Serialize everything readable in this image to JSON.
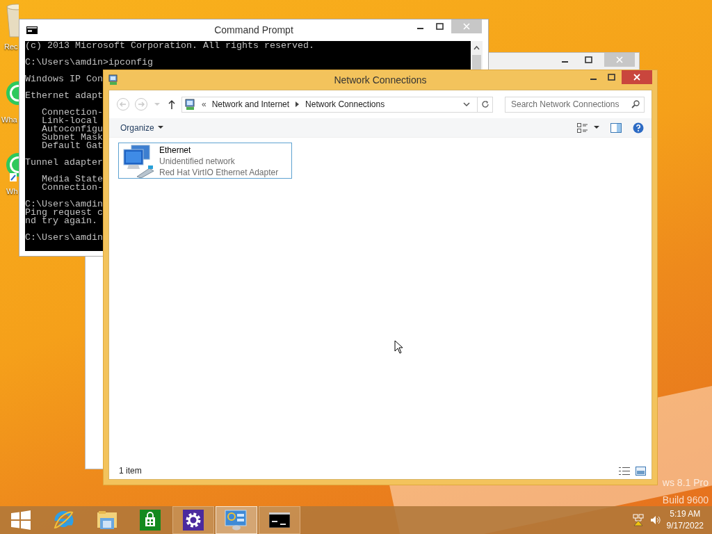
{
  "desktop": {
    "icons": [
      {
        "kind": "recycle",
        "label": "Rec"
      },
      {
        "kind": "chat",
        "label": "Wha"
      },
      {
        "kind": "chat-shortcut",
        "label": "Wh"
      }
    ],
    "watermark": [
      "ws 8.1 Pro",
      "Build 9600"
    ]
  },
  "command_prompt": {
    "title": "Command Prompt",
    "blocks": [
      [
        "(c) 2013 Microsoft Corporation. All rights reserved."
      ],
      [
        "C:\\Users\\amdin>ipconfig"
      ],
      [
        "Windows IP Con"
      ],
      [
        "Ethernet adapt"
      ],
      [
        "   Connection-",
        "   Link-local",
        "   Autoconfigu",
        "   Subnet Mask",
        "   Default Gat"
      ],
      [
        "Tunnel adapter"
      ],
      [
        "   Media State",
        "   Connection-"
      ],
      [
        "C:\\Users\\amdin",
        "Ping request c",
        "nd try again."
      ],
      [
        "C:\\Users\\amdin"
      ]
    ]
  },
  "network_connections": {
    "title": "Network Connections",
    "address": {
      "overflow": "«",
      "crumbs": [
        "Network and Internet",
        "Network Connections"
      ]
    },
    "search": {
      "placeholder": "Search Network Connections"
    },
    "organize": "Organize",
    "items": [
      {
        "name": "Ethernet",
        "status": "Unidentified network",
        "device": "Red Hat VirtIO Ethernet Adapter",
        "focused": true
      }
    ],
    "status_bar": "1 item"
  },
  "taskbar": {
    "buttons": [
      {
        "kind": "start",
        "running": false,
        "active": false
      },
      {
        "kind": "browser",
        "running": false,
        "active": false
      },
      {
        "kind": "files",
        "running": false,
        "active": false
      },
      {
        "kind": "store",
        "running": false,
        "active": false
      },
      {
        "kind": "settings",
        "running": true,
        "active": false
      },
      {
        "kind": "control-panel",
        "running": true,
        "active": true
      },
      {
        "kind": "console",
        "running": true,
        "active": false
      }
    ],
    "clock": {
      "time": "5:19 AM",
      "date": "9/17/2022"
    }
  }
}
